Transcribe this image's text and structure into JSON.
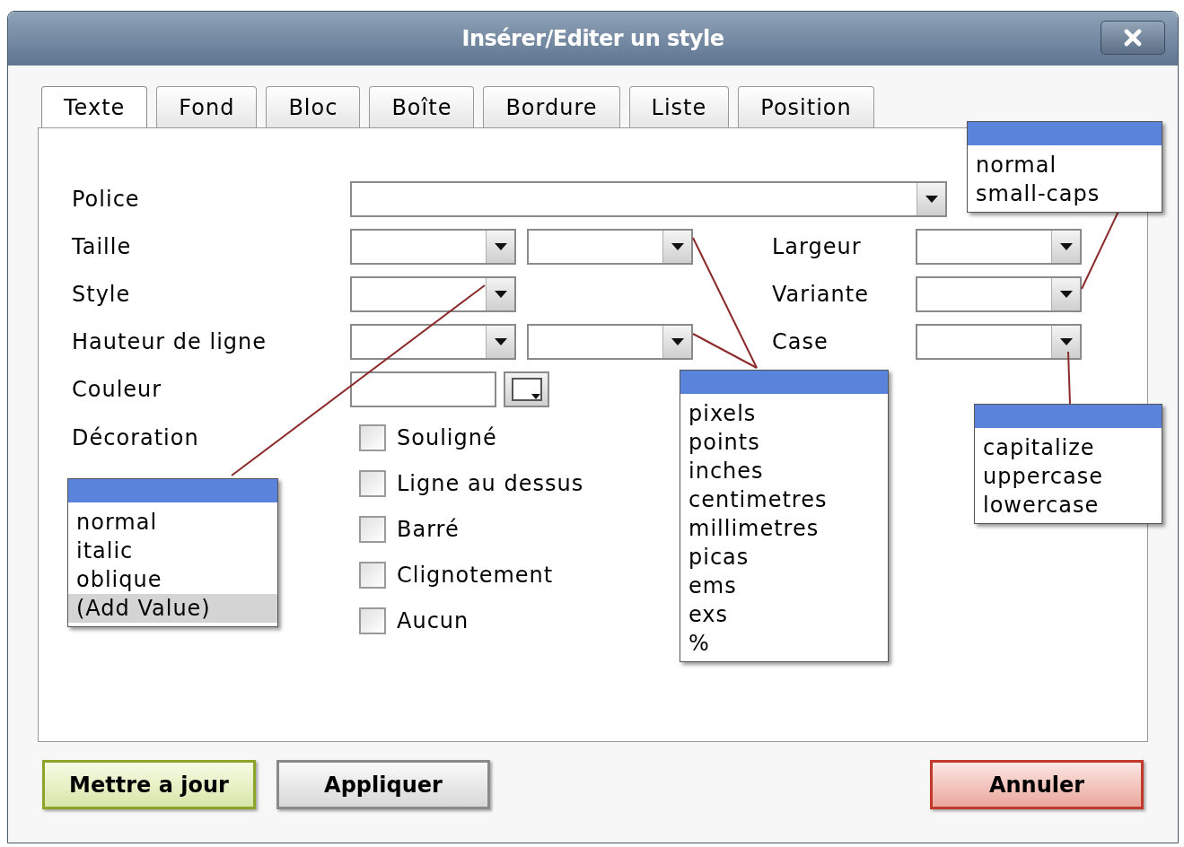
{
  "window": {
    "title": "Insérer/Editer un style"
  },
  "tabs": [
    {
      "label": "Texte",
      "selected": true
    },
    {
      "label": "Fond",
      "selected": false
    },
    {
      "label": "Bloc",
      "selected": false
    },
    {
      "label": "Boîte",
      "selected": false
    },
    {
      "label": "Bordure",
      "selected": false
    },
    {
      "label": "Liste",
      "selected": false
    },
    {
      "label": "Position",
      "selected": false
    }
  ],
  "fields": [
    {
      "label": "Police",
      "kind": "wide"
    },
    {
      "label": "Taille",
      "kind": "pair",
      "side_label": "Largeur"
    },
    {
      "label": "Style",
      "kind": "single",
      "side_label": "Variante"
    },
    {
      "label": "Hauteur de ligne",
      "kind": "pair",
      "side_label": "Case"
    },
    {
      "label": "Couleur",
      "kind": "color"
    }
  ],
  "decoration": {
    "label": "Décoration",
    "options": [
      {
        "label": "Souligné",
        "checked": false
      },
      {
        "label": "Ligne au dessus",
        "checked": false
      },
      {
        "label": "Barré",
        "checked": false
      },
      {
        "label": "Clignotement",
        "checked": false
      },
      {
        "label": "Aucun",
        "checked": false
      }
    ]
  },
  "dropdown_lists": [
    {
      "kind": "style",
      "items": [
        {
          "label": "normal",
          "highlighted": false
        },
        {
          "label": "italic",
          "highlighted": false
        },
        {
          "label": "oblique",
          "highlighted": false
        },
        {
          "label": "(Add Value)",
          "highlighted": true
        }
      ]
    },
    {
      "kind": "units",
      "items": [
        {
          "label": "pixels",
          "highlighted": false
        },
        {
          "label": "points",
          "highlighted": false
        },
        {
          "label": "inches",
          "highlighted": false
        },
        {
          "label": "centimetres",
          "highlighted": false
        },
        {
          "label": "millimetres",
          "highlighted": false
        },
        {
          "label": "picas",
          "highlighted": false
        },
        {
          "label": "ems",
          "highlighted": false
        },
        {
          "label": "exs",
          "highlighted": false
        },
        {
          "label": "%",
          "highlighted": false
        }
      ]
    },
    {
      "kind": "variant",
      "items": [
        {
          "label": "normal",
          "highlighted": false
        },
        {
          "label": "small-caps",
          "highlighted": false
        }
      ]
    },
    {
      "kind": "case",
      "items": [
        {
          "label": "capitalize",
          "highlighted": false
        },
        {
          "label": "uppercase",
          "highlighted": false
        },
        {
          "label": "lowercase",
          "highlighted": false
        }
      ]
    }
  ],
  "buttons": [
    {
      "label": "Mettre a jour",
      "kind": "update"
    },
    {
      "label": "Appliquer",
      "kind": "apply"
    },
    {
      "label": "Annuler",
      "kind": "cancel"
    }
  ]
}
